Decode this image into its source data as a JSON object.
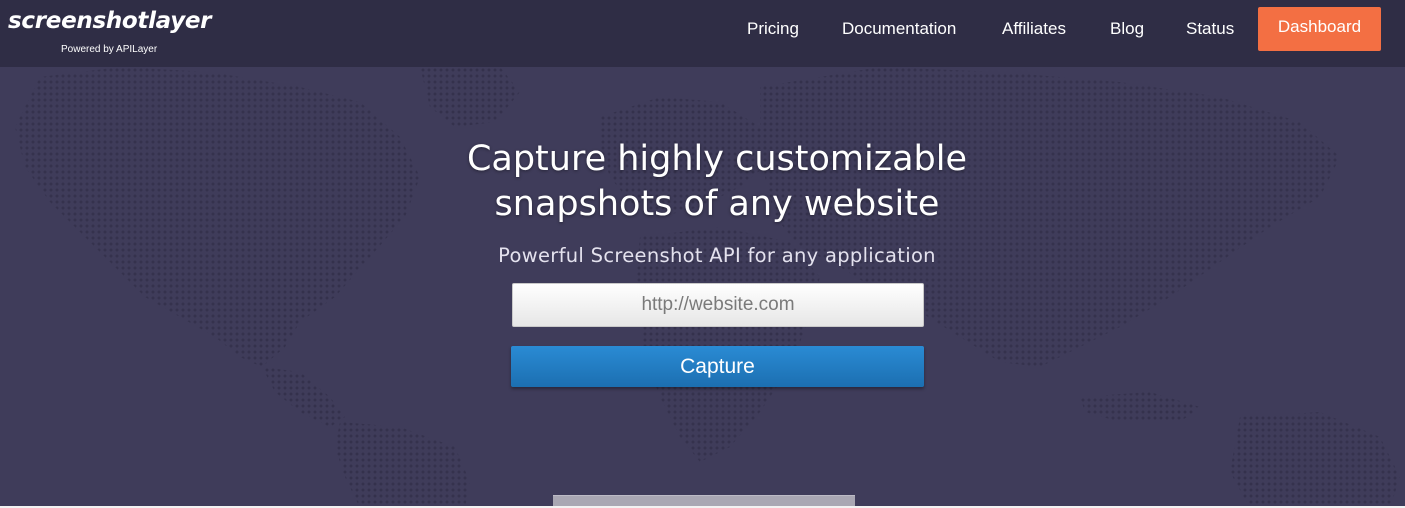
{
  "brand": {
    "logo_text": "screenshotlayer",
    "powered_by": "Powered by APILayer"
  },
  "nav": {
    "items": [
      {
        "label": "Pricing"
      },
      {
        "label": "Documentation"
      },
      {
        "label": "Affiliates"
      },
      {
        "label": "Blog"
      },
      {
        "label": "Status"
      }
    ],
    "dashboard_label": "Dashboard"
  },
  "hero": {
    "title_line1": "Capture highly customizable",
    "title_line2": "snapshots of any website",
    "subtitle": "Powerful Screenshot API for any application",
    "url_placeholder": "http://website.com",
    "url_value": "",
    "capture_label": "Capture"
  },
  "colors": {
    "navbar_bg": "#2f2d45",
    "hero_bg": "#3f3c5a",
    "dashboard_accent": "#f36f43",
    "capture_button": "#1f78c1"
  }
}
